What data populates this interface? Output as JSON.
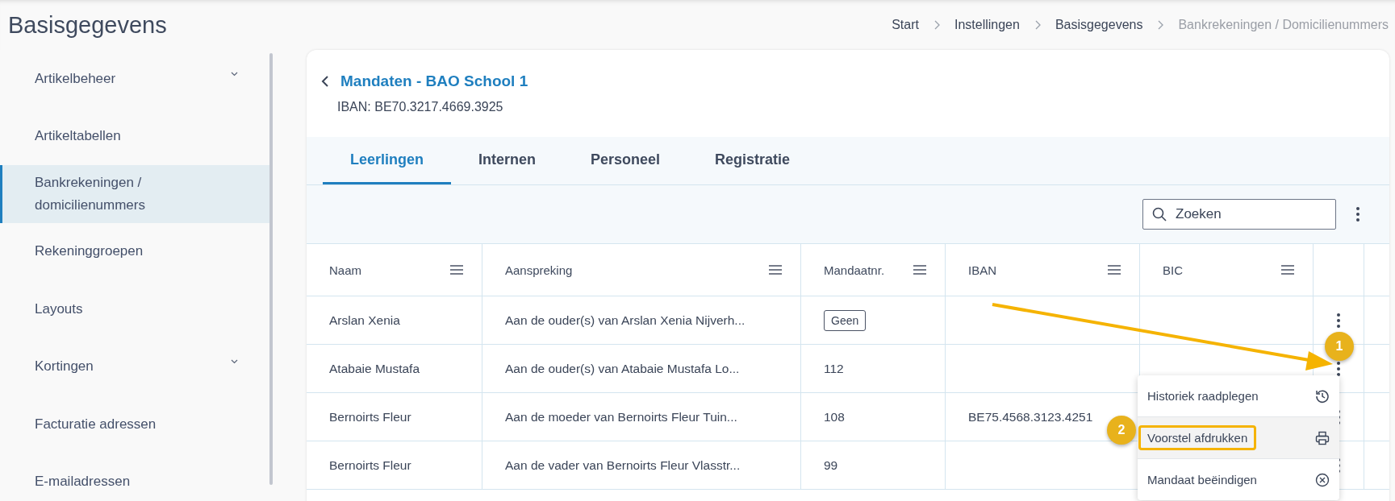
{
  "page_title": "Basisgegevens",
  "breadcrumb": [
    {
      "label": "Start",
      "current": false
    },
    {
      "label": "Instellingen",
      "current": false
    },
    {
      "label": "Basisgegevens",
      "current": false
    },
    {
      "label": "Bankrekeningen / Domicilienummers",
      "current": true
    }
  ],
  "sidebar": {
    "items": [
      {
        "label": "Artikelbeheer",
        "expandable": true,
        "selected": false
      },
      {
        "label": "Artikeltabellen",
        "expandable": false,
        "selected": false
      },
      {
        "label": "Bankrekeningen / domicilienummers",
        "expandable": false,
        "selected": true
      },
      {
        "label": "Rekeninggroepen",
        "expandable": false,
        "selected": false
      },
      {
        "label": "Layouts",
        "expandable": false,
        "selected": false
      },
      {
        "label": "Kortingen",
        "expandable": true,
        "selected": false
      },
      {
        "label": "Facturatie adressen",
        "expandable": false,
        "selected": false
      },
      {
        "label": "E-mailadressen",
        "expandable": false,
        "selected": false
      }
    ]
  },
  "card": {
    "title": "Mandaten - BAO School 1",
    "subtitle": "IBAN: BE70.3217.4669.3925"
  },
  "tabs": [
    {
      "label": "Leerlingen",
      "selected": true
    },
    {
      "label": "Internen",
      "selected": false
    },
    {
      "label": "Personeel",
      "selected": false
    },
    {
      "label": "Registratie",
      "selected": false
    }
  ],
  "search": {
    "placeholder": "Zoeken"
  },
  "table": {
    "columns": [
      "Naam",
      "Aanspreking",
      "Mandaatnr.",
      "IBAN",
      "BIC"
    ],
    "rows": [
      {
        "cells": [
          {
            "kind": "text",
            "text": "Arslan Xenia"
          },
          {
            "kind": "text",
            "text": "Aan de ouder(s) van Arslan Xenia Nijverh..."
          },
          {
            "kind": "tag",
            "text": "Geen"
          },
          {
            "kind": "empty"
          },
          {
            "kind": "empty"
          }
        ]
      },
      {
        "cells": [
          {
            "kind": "text",
            "text": "Atabaie Mustafa"
          },
          {
            "kind": "text",
            "text": "Aan de ouder(s) van Atabaie Mustafa Lo..."
          },
          {
            "kind": "text",
            "text": "112"
          },
          {
            "kind": "empty"
          },
          {
            "kind": "empty"
          }
        ]
      },
      {
        "cells": [
          {
            "kind": "text",
            "text": "Bernoirts Fleur"
          },
          {
            "kind": "text",
            "text": "Aan de moeder van Bernoirts Fleur Tuin..."
          },
          {
            "kind": "text",
            "text": "108"
          },
          {
            "kind": "text",
            "text": "BE75.4568.3123.4251"
          },
          {
            "kind": "empty"
          }
        ]
      },
      {
        "cells": [
          {
            "kind": "text",
            "text": "Bernoirts Fleur"
          },
          {
            "kind": "text",
            "text": "Aan de vader van Bernoirts Fleur Vlasstr..."
          },
          {
            "kind": "text",
            "text": "99"
          },
          {
            "kind": "empty"
          },
          {
            "kind": "empty"
          }
        ]
      }
    ]
  },
  "context_menu": {
    "items": [
      {
        "label": "Historiek raadplegen",
        "kind": "history",
        "selected": false,
        "outlined": false
      },
      {
        "label": "Voorstel afdrukken",
        "kind": "print",
        "selected": true,
        "outlined": true
      },
      {
        "label": "Mandaat beëindigen",
        "kind": "cancel",
        "selected": false,
        "outlined": false
      }
    ]
  },
  "annotations": [
    {
      "kind": "step",
      "text": "1"
    },
    {
      "kind": "step",
      "text": "2"
    },
    {
      "kind": "arrow"
    }
  ]
}
